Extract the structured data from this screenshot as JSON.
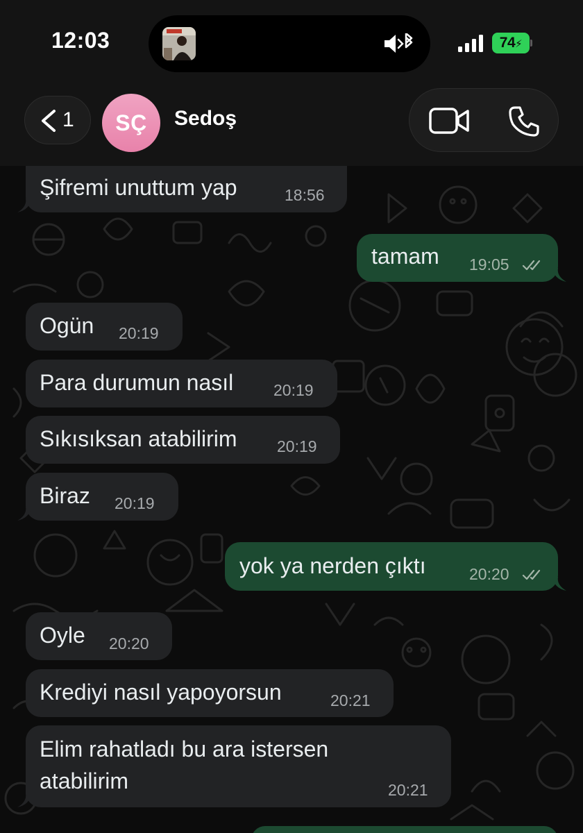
{
  "status_bar": {
    "time": "12:03",
    "battery": "74",
    "battery_color": "#2fd158"
  },
  "header": {
    "back_count": "1",
    "avatar_initials": "SÇ",
    "contact_name": "Sedoş",
    "avatar_color": "#ee93b6"
  },
  "messages": [
    {
      "direction": "incoming",
      "text": "Şifremi unuttum yap",
      "time": "18:56"
    },
    {
      "direction": "outgoing",
      "text": "tamam",
      "time": "19:05",
      "status": "read"
    },
    {
      "direction": "incoming",
      "text": "Ogün",
      "time": "20:19"
    },
    {
      "direction": "incoming",
      "text": "Para durumun nasıl",
      "time": "20:19"
    },
    {
      "direction": "incoming",
      "text": "Sıkısıksan atabilirim",
      "time": "20:19"
    },
    {
      "direction": "incoming",
      "text": "Biraz",
      "time": "20:19"
    },
    {
      "direction": "outgoing",
      "text": "yok ya nerden çıktı",
      "time": "20:20",
      "status": "read"
    },
    {
      "direction": "incoming",
      "text": "Oyle",
      "time": "20:20"
    },
    {
      "direction": "incoming",
      "text": "Krediyi nasıl yapoyorsun",
      "time": "20:21"
    },
    {
      "direction": "incoming",
      "text_lines": [
        "Elim rahatladı bu ara istersen",
        "atabilirim"
      ],
      "time": "20:21"
    }
  ],
  "colors": {
    "incoming_bubble": "#222325",
    "outgoing_bubble": "#1c4a31",
    "background": "#0c0c0c"
  }
}
